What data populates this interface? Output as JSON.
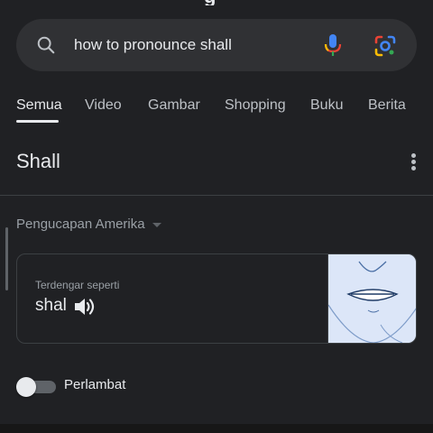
{
  "header": {
    "logo_peek": "g"
  },
  "search": {
    "query": "how to pronounce shall"
  },
  "tabs": [
    {
      "label": "Semua"
    },
    {
      "label": "Video"
    },
    {
      "label": "Gambar"
    },
    {
      "label": "Shopping"
    },
    {
      "label": "Buku"
    },
    {
      "label": "Berita"
    }
  ],
  "result": {
    "word": "Shall",
    "accent": "Pengucapan Amerika",
    "sounds_like_label": "Terdengar seperti",
    "phonetic": "shal",
    "slow_label": "Perlambat"
  },
  "colors": {
    "background": "#202124",
    "search_bg": "#303134",
    "text": "#e8eaed",
    "mouth_bg": "#dce6f8"
  },
  "icons": [
    "search-icon",
    "mic-icon",
    "lens-icon",
    "more-vert-icon",
    "speaker-icon"
  ]
}
